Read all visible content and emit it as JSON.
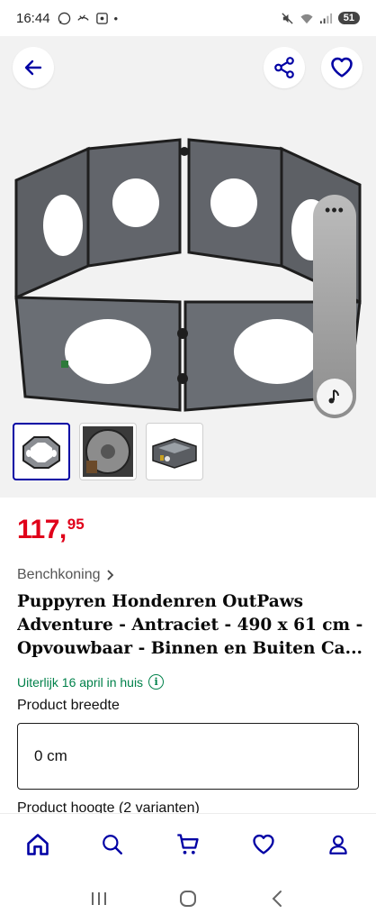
{
  "status_bar": {
    "time": "16:44",
    "battery": "51"
  },
  "product": {
    "price_main": "117,",
    "price_cents": "95",
    "seller": "Benchkoning",
    "title": "Puppyren Hondenren OutPaws Adventure - Antraciet - 490 x 61 cm - Opvouwbaar - Binnen en Buiten Ca...",
    "delivery": "Uiterlijk 16 april in huis"
  },
  "options": {
    "width_label": "Product breedte",
    "width_value": "0 cm",
    "height_label": "Product hoogte (2 varianten)"
  },
  "float_panel": {
    "dots": "•••"
  },
  "icons": {
    "back": "arrow-left-icon",
    "share": "share-icon",
    "favorite": "heart-icon",
    "music": "music-note-icon",
    "info": "info-icon",
    "chevron": "chevron-right-icon"
  },
  "colors": {
    "brand_blue": "#0000a4",
    "price_red": "#e0001a",
    "delivery_green": "#00814a"
  }
}
